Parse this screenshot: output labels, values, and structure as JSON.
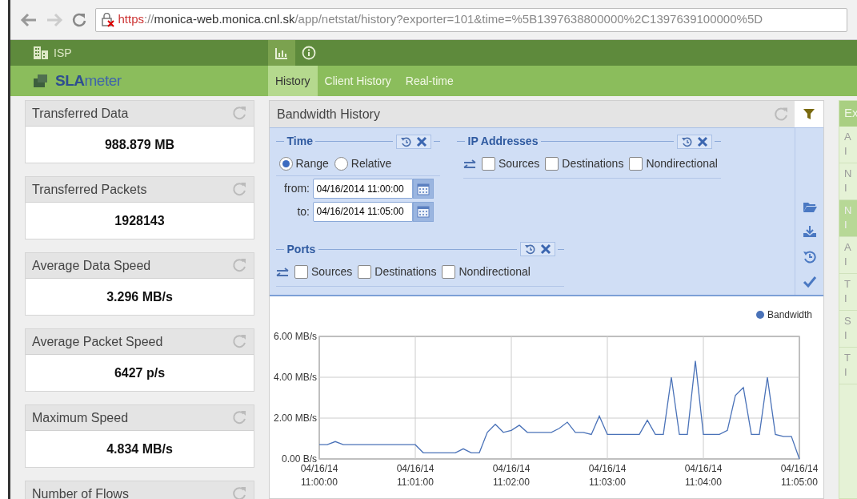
{
  "browser": {
    "url_scheme": "https",
    "url_sep": "://",
    "url_host": "monica-web.monica.cnl.sk",
    "url_path": "/app/netstat/history?exporter=101&time=%5B1397638800000%2C1397639100000%5D"
  },
  "app_bar": {
    "org": "ISP",
    "icon_tabs": [
      {
        "kind": "chart",
        "selected": true
      },
      {
        "kind": "info",
        "selected": false
      }
    ]
  },
  "nav_bar": {
    "logo_main": "SLA",
    "logo_rest": "meter",
    "tabs": [
      {
        "label": "History",
        "selected": true
      },
      {
        "label": "Client History",
        "selected": false
      },
      {
        "label": "Real-time",
        "selected": false
      }
    ]
  },
  "stats": [
    {
      "title": "Transferred Data",
      "value": "988.879 MB"
    },
    {
      "title": "Transferred Packets",
      "value": "1928143"
    },
    {
      "title": "Average Data Speed",
      "value": "3.296 MB/s"
    },
    {
      "title": "Average Packet Speed",
      "value": "6427 p/s"
    },
    {
      "title": "Maximum Speed",
      "value": "4.834 MB/s"
    },
    {
      "title": "Number of Flows"
    }
  ],
  "panel": {
    "title": "Bandwidth History",
    "filter": {
      "time": {
        "title": "Time",
        "modes": [
          {
            "label": "Range",
            "selected": true
          },
          {
            "label": "Relative",
            "selected": false
          }
        ],
        "from_label": "from:",
        "from_value": "04/16/2014 11:00:00",
        "to_label": "to:",
        "to_value": "04/16/2014 11:05:00"
      },
      "ip": {
        "title": "IP Addresses",
        "options": [
          {
            "label": "Sources",
            "checked": false
          },
          {
            "label": "Destinations",
            "checked": false
          },
          {
            "label": "Nondirectional",
            "checked": false
          }
        ]
      },
      "ports": {
        "title": "Ports",
        "options": [
          {
            "label": "Sources",
            "checked": false
          },
          {
            "label": "Destinations",
            "checked": false
          },
          {
            "label": "Nondirectional",
            "checked": false
          }
        ]
      },
      "actions": [
        {
          "kind": "folder"
        },
        {
          "kind": "download"
        },
        {
          "kind": "history"
        },
        {
          "kind": "check"
        }
      ]
    },
    "chart_data": {
      "type": "line",
      "grid": true,
      "ylim": [
        0,
        6
      ],
      "yticks": [
        {
          "value": 0,
          "label": "0.00 B/s"
        },
        {
          "value": 2,
          "label": "2.00 MB/s"
        },
        {
          "value": 4,
          "label": "4.00 MB/s"
        },
        {
          "value": 6,
          "label": "6.00 MB/s"
        }
      ],
      "categories": [
        "04/16/14 11:00:00",
        null,
        null,
        null,
        null,
        null,
        null,
        null,
        null,
        null,
        null,
        null,
        "04/16/14 11:01:00",
        null,
        null,
        null,
        null,
        null,
        null,
        null,
        null,
        null,
        null,
        null,
        "04/16/14 11:02:00",
        null,
        null,
        null,
        null,
        null,
        null,
        null,
        null,
        null,
        null,
        null,
        "04/16/14 11:03:00",
        null,
        null,
        null,
        null,
        null,
        null,
        null,
        null,
        null,
        null,
        null,
        "04/16/14 11:04:00",
        null,
        null,
        null,
        null,
        null,
        null,
        null,
        null,
        null,
        null,
        null,
        "04/16/14 11:05:00"
      ],
      "series": [
        {
          "name": "Bandwidth",
          "color": "#4a72b8",
          "values": [
            0.7,
            0.7,
            0.85,
            0.7,
            0.7,
            0.7,
            0.7,
            0.7,
            0.7,
            0.7,
            0.7,
            0.7,
            0.7,
            0.3,
            0.3,
            0.3,
            0.3,
            0.3,
            0.5,
            0.3,
            0.3,
            1.3,
            1.7,
            1.3,
            1.4,
            1.65,
            1.3,
            1.3,
            1.3,
            1.3,
            1.5,
            1.8,
            1.3,
            1.3,
            1.2,
            2.1,
            1.2,
            1.2,
            1.2,
            1.2,
            1.2,
            1.9,
            1.2,
            1.2,
            4.0,
            1.2,
            1.2,
            4.8,
            1.2,
            1.2,
            1.2,
            1.4,
            3.1,
            3.5,
            1.2,
            1.2,
            4.0,
            1.2,
            1.1,
            1.1,
            0
          ]
        }
      ]
    }
  },
  "side_panel": {
    "header": "Ex",
    "items": [
      {
        "label": "A",
        "sub": "I",
        "selected": false
      },
      {
        "label": "N",
        "sub": "I",
        "selected": false
      },
      {
        "label": "N",
        "sub": "I",
        "selected": true
      },
      {
        "label": "A",
        "sub": "I",
        "selected": false
      },
      {
        "label": "T",
        "sub": "I",
        "selected": false
      },
      {
        "label": "S",
        "sub": "I",
        "selected": false
      },
      {
        "label": "T",
        "sub": "I",
        "selected": false
      }
    ]
  }
}
